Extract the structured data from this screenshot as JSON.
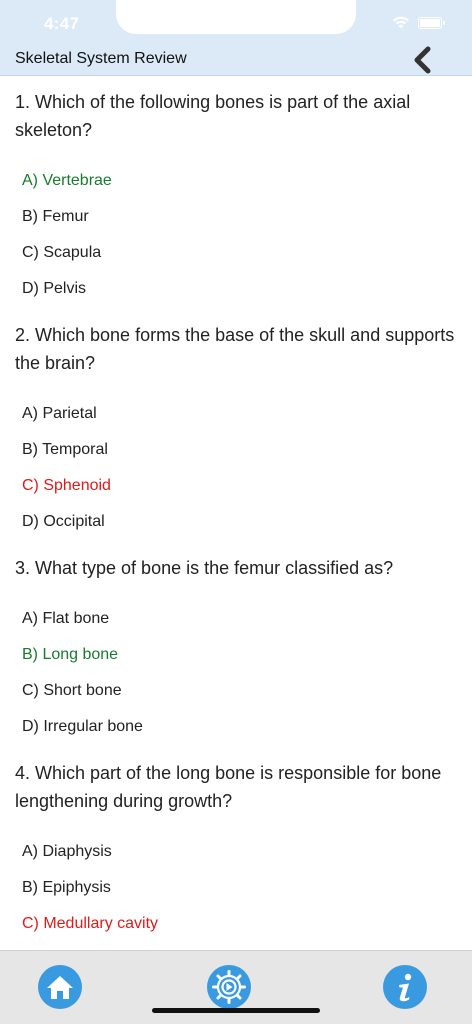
{
  "status": {
    "time": "4:47"
  },
  "nav": {
    "title": "Skeletal System Review"
  },
  "questions": [
    {
      "text": "1. Which of the following bones is part of the axial skeleton?",
      "options": [
        {
          "label": "A) Vertebrae",
          "state": "correct"
        },
        {
          "label": "B) Femur",
          "state": ""
        },
        {
          "label": "C) Scapula",
          "state": ""
        },
        {
          "label": "D) Pelvis",
          "state": ""
        }
      ]
    },
    {
      "text": "2. Which bone forms the base of the skull and supports the brain?",
      "options": [
        {
          "label": "A) Parietal",
          "state": ""
        },
        {
          "label": "B) Temporal",
          "state": ""
        },
        {
          "label": "C) Sphenoid",
          "state": "wrong"
        },
        {
          "label": "D) Occipital",
          "state": ""
        }
      ]
    },
    {
      "text": "3. What type of bone is the femur classified as?",
      "options": [
        {
          "label": "A) Flat bone",
          "state": ""
        },
        {
          "label": "B) Long bone",
          "state": "correct"
        },
        {
          "label": "C) Short bone",
          "state": ""
        },
        {
          "label": "D) Irregular bone",
          "state": ""
        }
      ]
    },
    {
      "text": "4. Which part of the long bone is responsible for bone lengthening during growth?",
      "options": [
        {
          "label": "A) Diaphysis",
          "state": ""
        },
        {
          "label": "B) Epiphysis",
          "state": ""
        },
        {
          "label": "C) Medullary cavity",
          "state": "wrong"
        }
      ]
    }
  ],
  "tabbar": {
    "items": [
      {
        "icon": "home-icon"
      },
      {
        "icon": "gear-icon"
      },
      {
        "icon": "info-icon"
      }
    ]
  },
  "colors": {
    "header": "#dce9f7",
    "correct": "#1a7a2e",
    "wrong": "#e01a1a",
    "tab_button": "#3a9ae0"
  }
}
